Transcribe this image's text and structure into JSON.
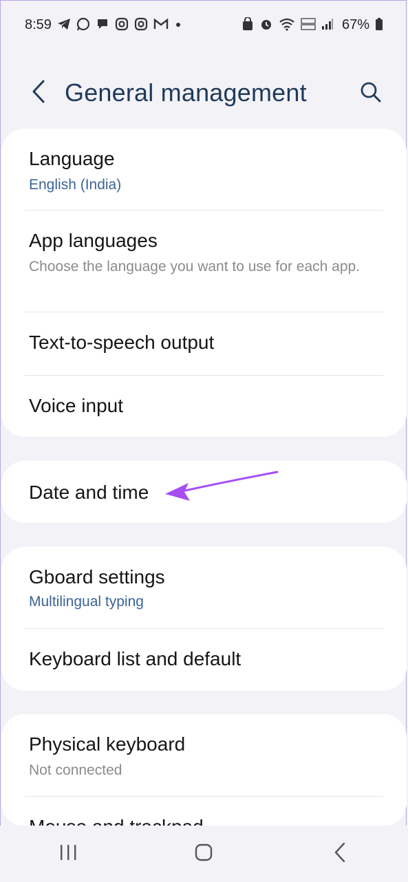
{
  "status_bar": {
    "time": "8:59",
    "battery": "67%"
  },
  "header": {
    "title": "General management"
  },
  "cards": [
    {
      "items": [
        {
          "label": "Language",
          "subtitle": "English (India)"
        },
        {
          "label": "App languages",
          "subtitle": "Choose the language you want to use for each app."
        },
        {
          "label": "Text-to-speech output"
        },
        {
          "label": "Voice input"
        }
      ]
    },
    {
      "items": [
        {
          "label": "Date and time"
        }
      ]
    },
    {
      "items": [
        {
          "label": "Gboard settings",
          "subtitle": "Multilingual typing"
        },
        {
          "label": "Keyboard list and default"
        }
      ]
    },
    {
      "items": [
        {
          "label": "Physical keyboard",
          "subtitle": "Not connected"
        },
        {
          "label": "Mouse and trackpad"
        }
      ]
    }
  ],
  "colors": {
    "accent_arrow": "#a64ef2",
    "title": "#1f3b5c",
    "subtitle_blue": "#3b6496"
  }
}
